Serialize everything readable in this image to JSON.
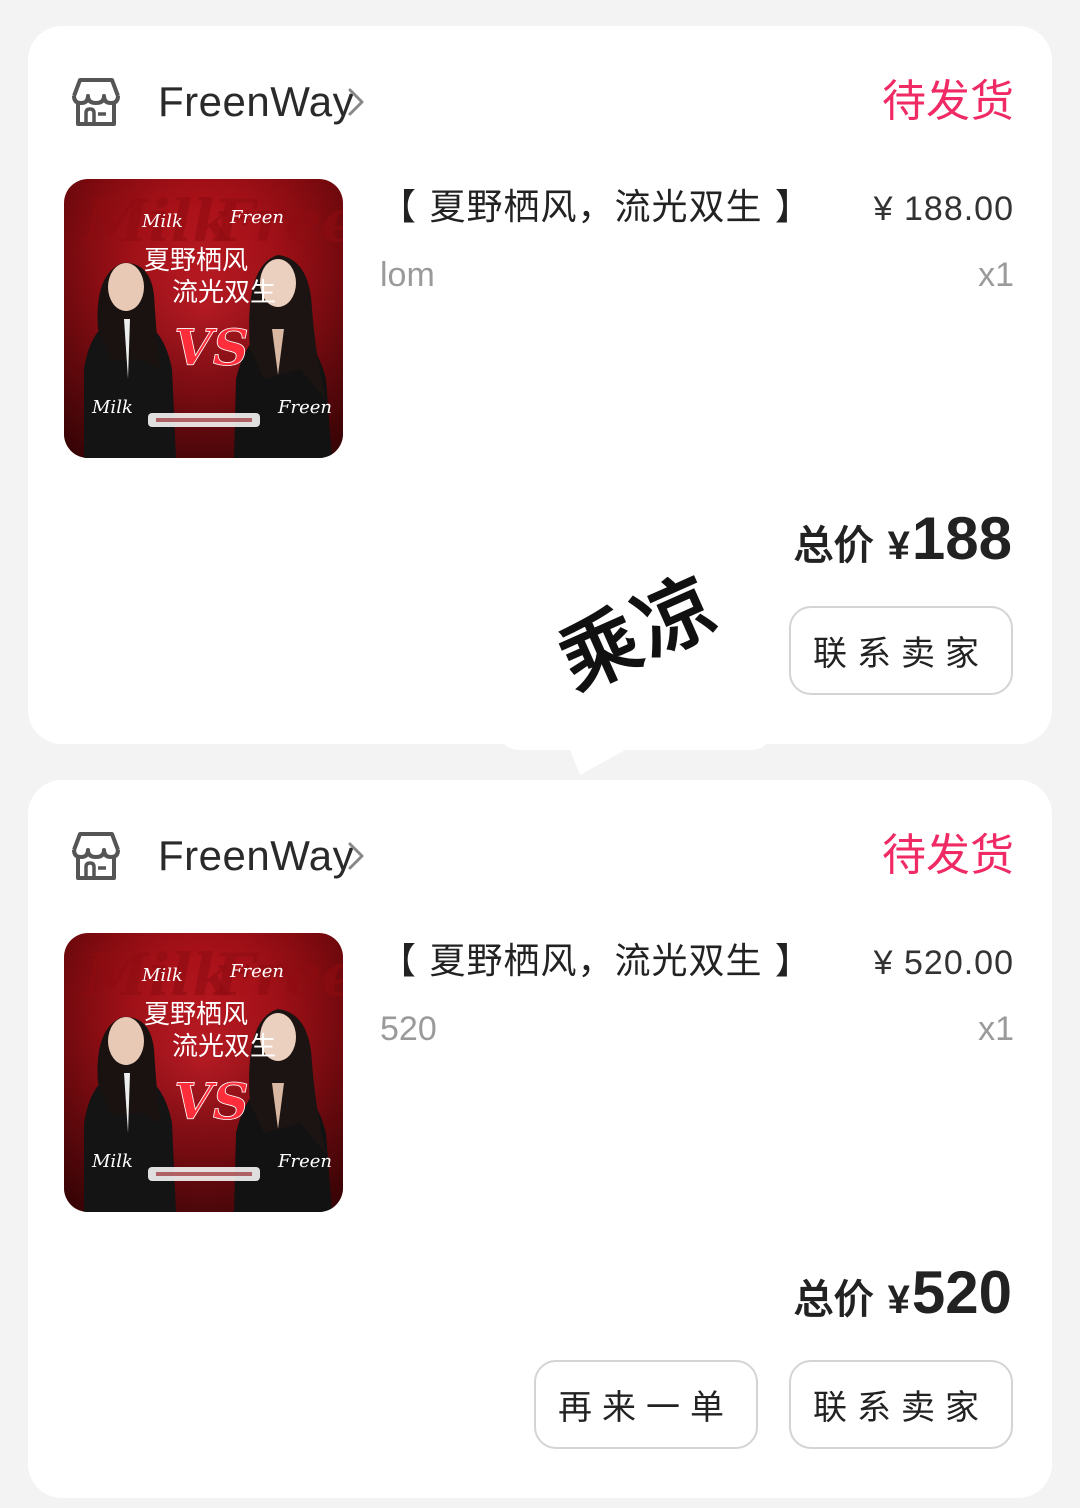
{
  "orders": [
    {
      "store_name": "FreenWay",
      "status": "待发货",
      "product_title": "【 夏野栖风，流光双生 】",
      "price": "¥ 188.00",
      "spec": "lom",
      "quantity": "x1",
      "total_label": "总价",
      "total_currency": "¥",
      "total_value": "188",
      "contact_button": "联系卖家",
      "image_texts": {
        "script_top_left": "Milk",
        "script_top_right": "Freen",
        "headline_1": "夏野栖风",
        "headline_2": "流光双生",
        "versus": "VS",
        "bottom_left": "Milk",
        "bottom_right": "Freen"
      }
    },
    {
      "store_name": "FreenWay",
      "status": "待发货",
      "product_title": "【 夏野栖风，流光双生 】",
      "price": "¥ 520.00",
      "spec": "520",
      "quantity": "x1",
      "total_label": "总价",
      "total_currency": "¥",
      "total_value": "520",
      "reorder_button": "再来一单",
      "contact_button": "联系卖家",
      "image_texts": {
        "script_top_left": "Milk",
        "script_top_right": "Freen",
        "headline_1": "夏野栖风",
        "headline_2": "流光双生",
        "versus": "VS",
        "bottom_left": "Milk",
        "bottom_right": "Freen"
      }
    }
  ],
  "overlay_handwriting": "乘凉",
  "colors": {
    "status": "#ef2a64",
    "page_background": "#f3f3f3",
    "card_background": "#ffffff",
    "button_border": "#d4d4d4"
  },
  "icons": [
    "store-icon",
    "chevron-right-icon"
  ]
}
